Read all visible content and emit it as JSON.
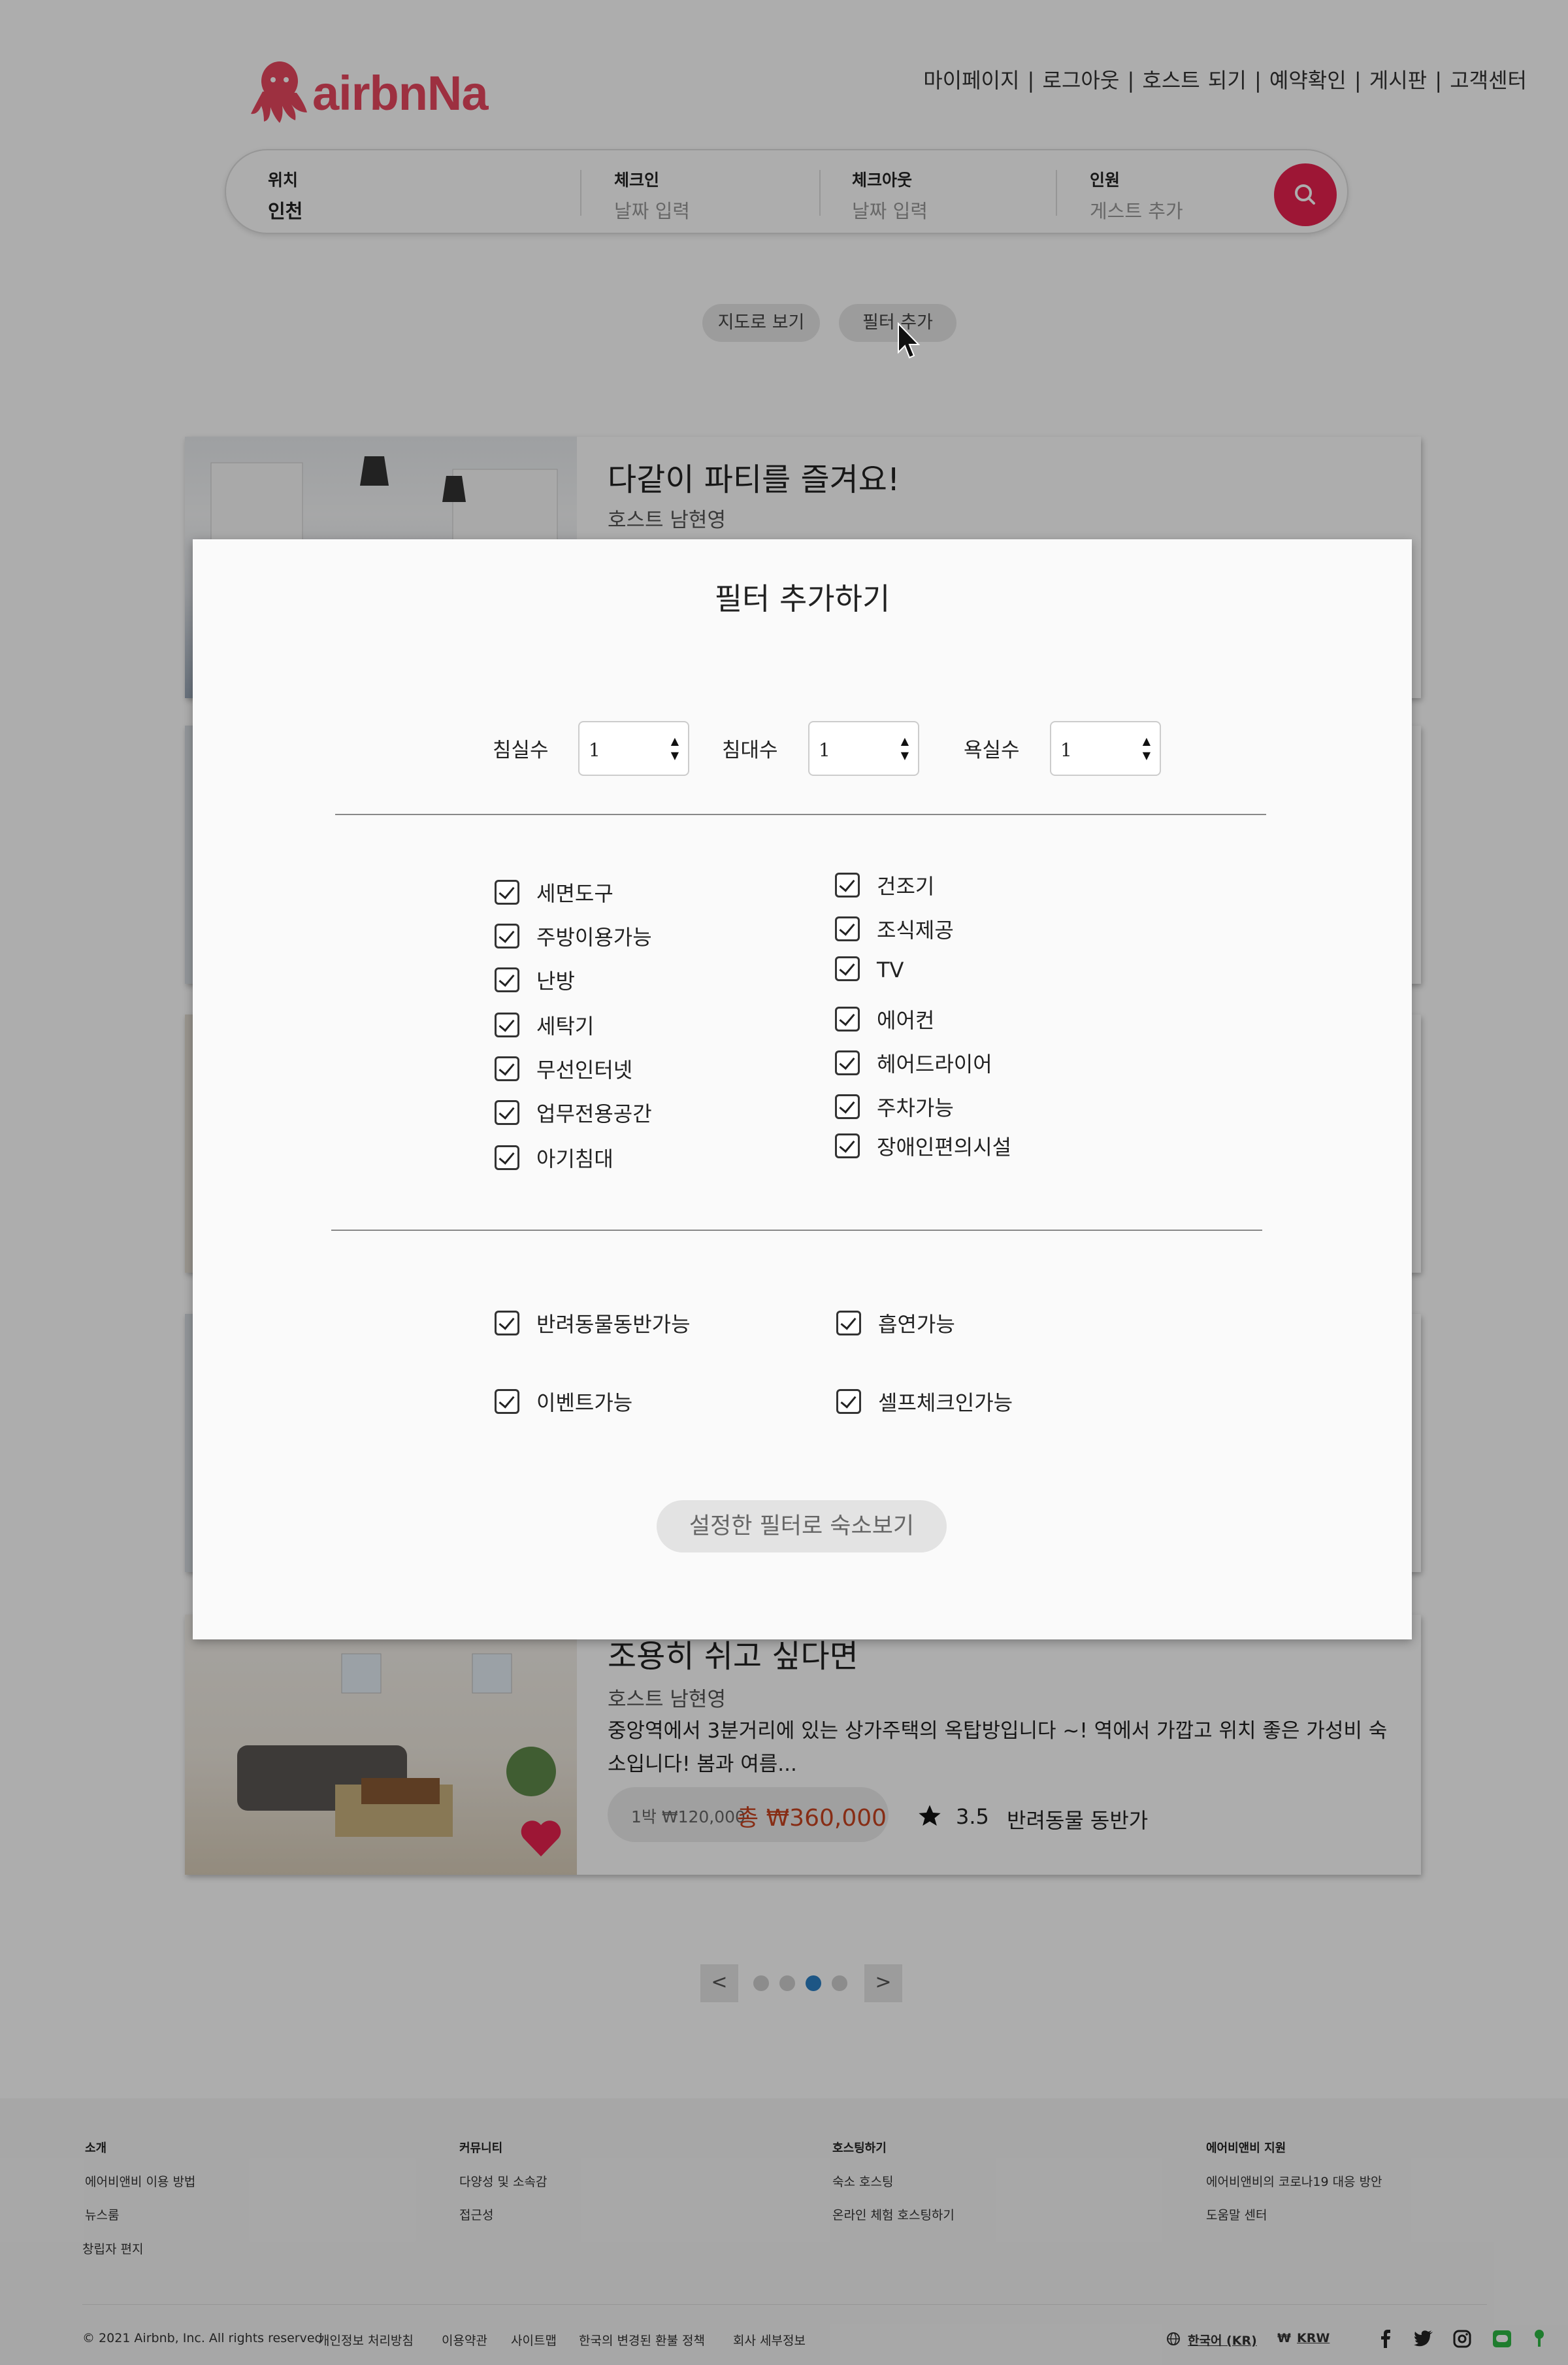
{
  "header": {
    "logo_text": "airbnNa",
    "nav_text": "마이페이지 | 로그아웃 | 호스트 되기 | 예약확인 | 게시판 | 고객센터"
  },
  "search": {
    "location_label": "위치",
    "location_value": "인천",
    "checkin_label": "체크인",
    "checkin_value": "날짜 입력",
    "checkout_label": "체크아웃",
    "checkout_value": "날짜 입력",
    "guests_label": "인원",
    "guests_value": "게스트 추가"
  },
  "toolbar": {
    "map_view": "지도로 보기",
    "add_filter": "필터 추가"
  },
  "listings": [
    {
      "title": "다같이 파티를 즐겨요!",
      "host": "호스트 남현영"
    },
    {
      "title": "조용히 쉬고 싶다면",
      "host": "호스트 남현영",
      "description": "중앙역에서 3분거리에 있는 상가주택의 옥탑방입니다 ~! 역에서 가깝고 위치 좋은 가성비 숙소입니다! 봄과 여름...",
      "price_per_night": "1박 ₩120,000",
      "price_total": "총 ₩360,000",
      "rating": "3.5",
      "tag": "반려동물 동반가"
    }
  ],
  "modal": {
    "title": "필터 추가하기",
    "bedrooms_label": "침실수",
    "bedrooms_value": "1",
    "beds_label": "침대수",
    "beds_value": "1",
    "baths_label": "욕실수",
    "baths_value": "1",
    "amenities_left": [
      "세면도구",
      "주방이용가능",
      "난방",
      "세탁기",
      "무선인터넷",
      "업무전용공간",
      "아기침대"
    ],
    "amenities_right": [
      "건조기",
      "조식제공",
      "TV",
      "에어컨",
      "헤어드라이어",
      "주차가능",
      "장애인편의시설"
    ],
    "rules": [
      "반려동물동반가능",
      "흡연가능",
      "이벤트가능",
      "셀프체크인가능"
    ],
    "submit": "설정한 필터로 숙소보기"
  },
  "pagination": {
    "prev": "<",
    "next": ">",
    "pages": 4,
    "current": 3
  },
  "footer": {
    "col1_title": "소개",
    "col1_links": [
      "에어비앤비 이용 방법",
      "뉴스룸",
      "창립자 편지"
    ],
    "col2_title": "커뮤니티",
    "col2_links": [
      "다양성 및 소속감",
      "접근성"
    ],
    "col3_title": "호스팅하기",
    "col3_links": [
      "숙소 호스팅",
      "온라인 체험 호스팅하기"
    ],
    "col4_title": "에어비앤비 지원",
    "col4_links": [
      "에어비앤비의 코로나19 대응 방안",
      "도움말 센터"
    ],
    "copyright": "© 2021 Airbnb, Inc. All rights reserved",
    "legal_links": [
      "개인정보 처리방침",
      "이용약관",
      "사이트맵",
      "한국의 변경된 환불 정책",
      "회사 세부정보"
    ],
    "language": "한국어 (KR)",
    "currency_symbol": "₩",
    "currency": "KRW"
  },
  "colors": {
    "brand": "#e8485f",
    "search_button": "#e8214f",
    "price_total": "#c8431f",
    "active_dot": "#2b7fc4"
  },
  "icons": [
    "octopus-logo-icon",
    "search-icon",
    "cursor-icon",
    "heart-icon",
    "star-icon",
    "globe-icon",
    "facebook-icon",
    "twitter-icon",
    "instagram-icon",
    "line-icon",
    "naver-icon"
  ]
}
